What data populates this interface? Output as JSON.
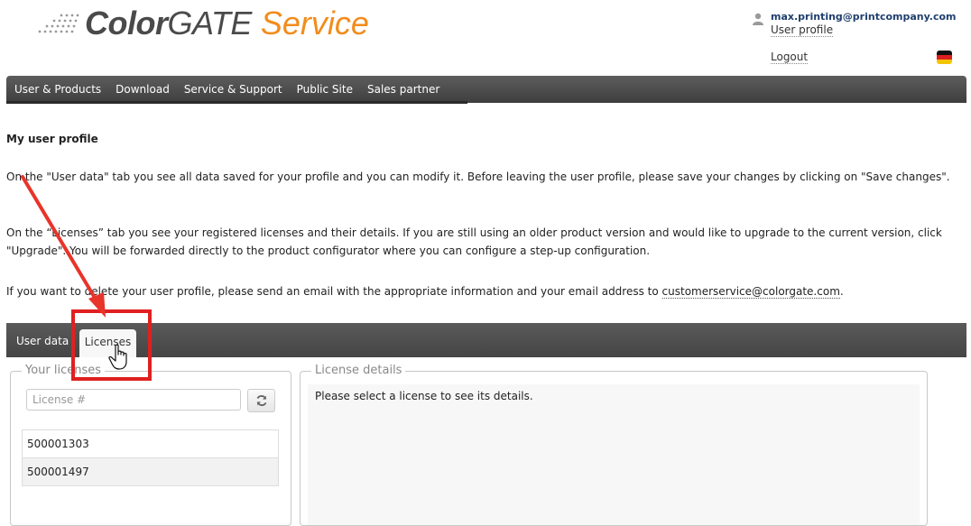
{
  "header": {
    "logo_color": "Color",
    "logo_gate": "GATE",
    "logo_service": "Service",
    "user_email": "max.printing@printcompany.com",
    "user_profile": "User profile",
    "logout": "Logout"
  },
  "nav": {
    "items": [
      {
        "label": "User & Products"
      },
      {
        "label": "Download"
      },
      {
        "label": "Service & Support"
      },
      {
        "label": "Public Site"
      },
      {
        "label": "Sales partner"
      }
    ]
  },
  "content": {
    "title": "My user profile",
    "para1": "On the \"User data\" tab you see all data saved for your profile and you can modify it. Before leaving the user profile, please save your changes by clicking on \"Save changes\".",
    "para2": "On the “Licenses” tab you see your registered licenses and their details. If you are still using an older product version and would like to upgrade to the current version, click \"Upgrade\". You will be forwarded directly to the product configurator where you can configure a step-up configuration.",
    "para3_prefix": "If you want to delete your user profile, please send an email with the appropriate information and your email address to ",
    "para3_email": "customerservice@colorgate.com",
    "para3_suffix": "."
  },
  "tabs": {
    "user_data": "User data",
    "licenses": "Licenses"
  },
  "licenses_panel": {
    "legend": "Your licenses",
    "search_placeholder": "License #",
    "search_value": "",
    "items": [
      "500001303",
      "500001497"
    ]
  },
  "details_panel": {
    "legend": "License details",
    "message": "Please select a license to see its details."
  },
  "colors": {
    "accent_orange": "#f28c1c",
    "navbar": "#4a4a4a",
    "annotation_red": "#e02020"
  },
  "icons": {
    "user": "user-icon",
    "flag": "german-flag-icon",
    "refresh": "refresh-icon",
    "cursor": "hand-cursor-icon",
    "arrow": "annotation-arrow"
  }
}
